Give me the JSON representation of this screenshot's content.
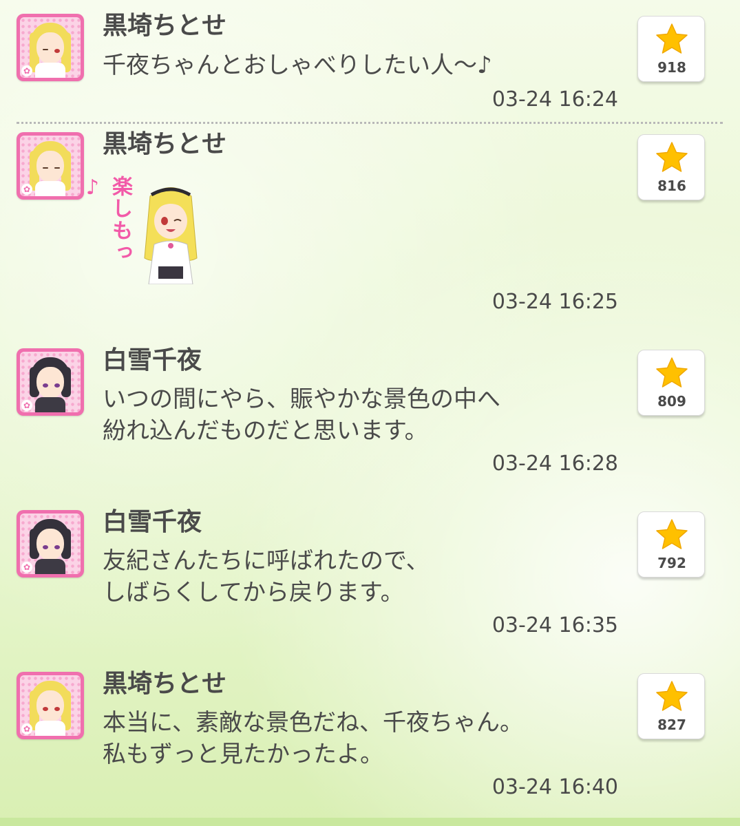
{
  "posts": [
    {
      "author": "黒埼ちとせ",
      "message": "千夜ちゃんとおしゃべりしたい人〜♪",
      "timestamp": "03-24 16:24",
      "likes": "918",
      "avatar": "chitose"
    },
    {
      "author": "黒埼ちとせ",
      "stamp_text": "楽しもっ♪",
      "timestamp": "03-24 16:25",
      "likes": "816",
      "avatar": "chitose"
    },
    {
      "author": "白雪千夜",
      "message": "いつの間にやら、賑やかな景色の中へ\n紛れ込んだものだと思います。",
      "timestamp": "03-24 16:28",
      "likes": "809",
      "avatar": "chiyo"
    },
    {
      "author": "白雪千夜",
      "message": "友紀さんたちに呼ばれたので、\nしばらくしてから戻ります。",
      "timestamp": "03-24 16:35",
      "likes": "792",
      "avatar": "chiyo"
    },
    {
      "author": "黒埼ちとせ",
      "message": "本当に、素敵な景色だね、千夜ちゃん。\n私もずっと見たかったよ。",
      "timestamp": "03-24 16:40",
      "likes": "827",
      "avatar": "chitose"
    }
  ],
  "colors": {
    "avatar_frame": "#f06fae",
    "star": "#ffc000",
    "text": "#4a4a4a",
    "background": "#eaf7d4"
  },
  "icons": {
    "like": "star-icon",
    "avatar_badge": "flower-icon"
  }
}
